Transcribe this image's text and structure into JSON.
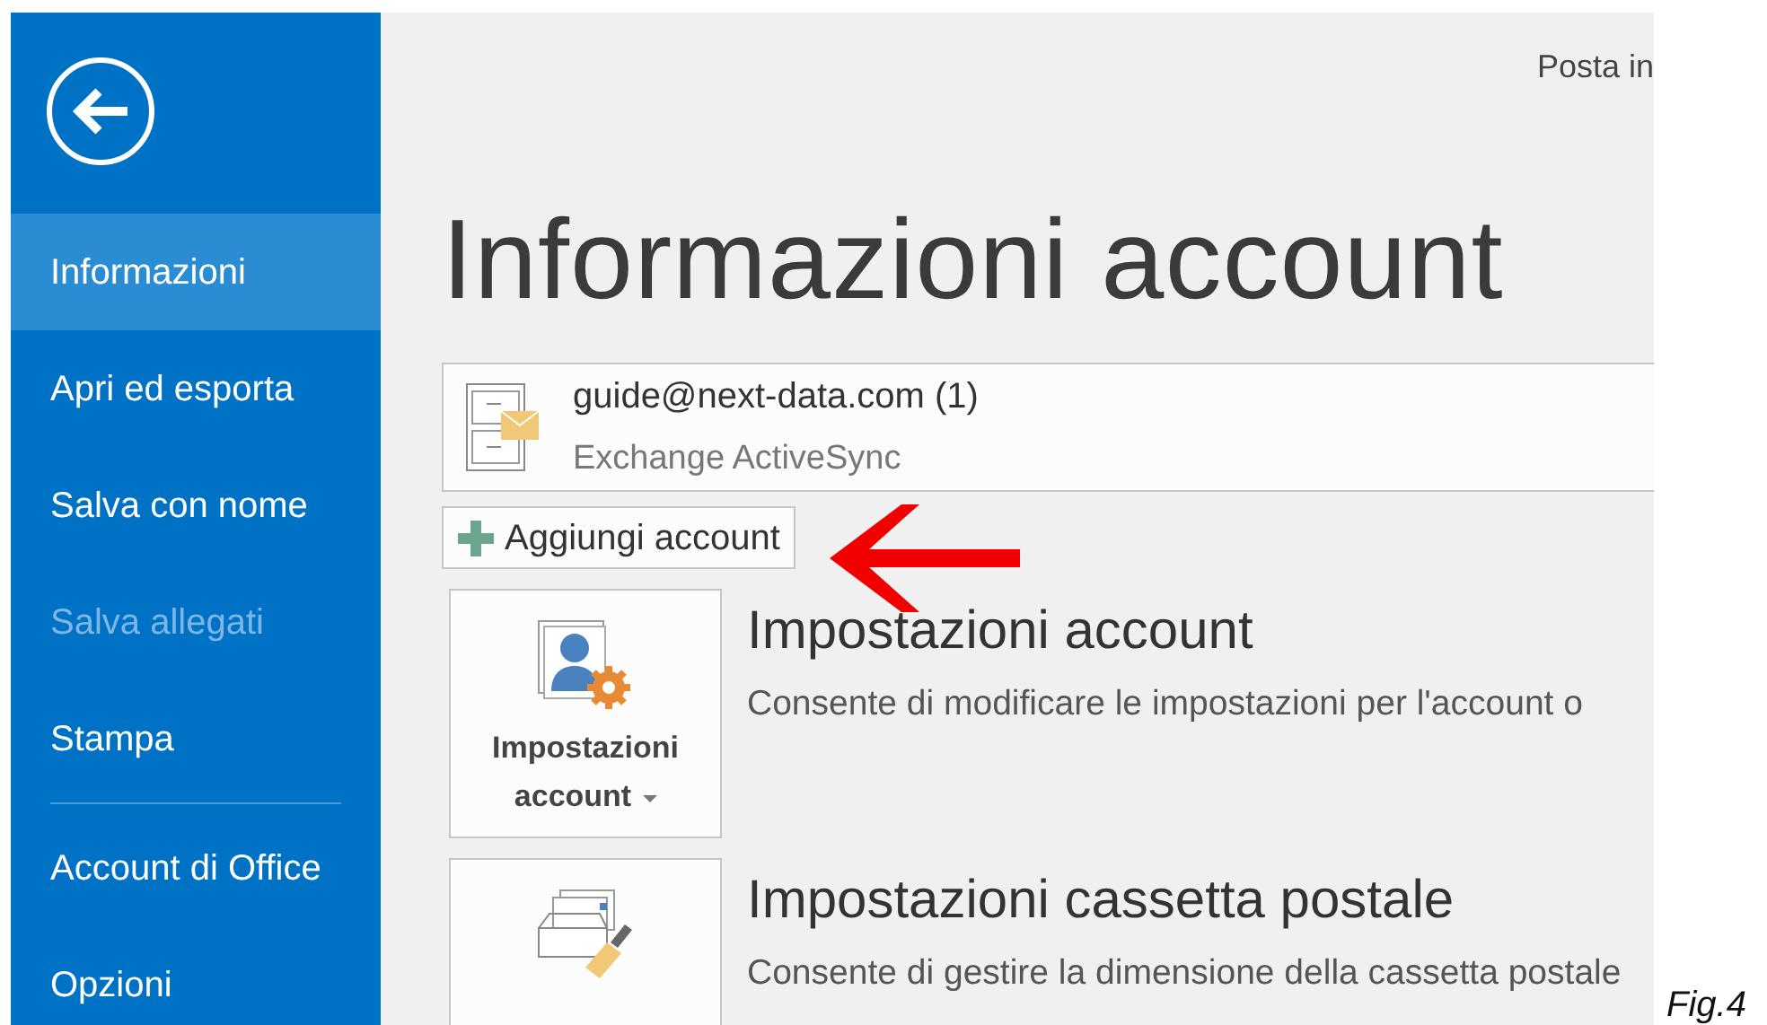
{
  "sidebar": {
    "groups": [
      [
        {
          "label": "Informazioni",
          "selected": true,
          "disabled": false
        },
        {
          "label": "Apri ed esporta",
          "selected": false,
          "disabled": false
        },
        {
          "label": "Salva con nome",
          "selected": false,
          "disabled": false
        },
        {
          "label": "Salva allegati",
          "selected": false,
          "disabled": true
        },
        {
          "label": "Stampa",
          "selected": false,
          "disabled": false
        }
      ],
      [
        {
          "label": "Account di Office",
          "selected": false,
          "disabled": false
        },
        {
          "label": "Opzioni",
          "selected": false,
          "disabled": false
        }
      ]
    ]
  },
  "header_text": "Posta in",
  "title": "Informazioni account",
  "account": {
    "email": "guide@next-data.com (1)",
    "type": "Exchange ActiveSync"
  },
  "add_account_button": "Aggiungi account",
  "sections": [
    {
      "kind": "account-settings",
      "button_label": "Impostazioni account",
      "dropdown": true,
      "heading": "Impostazioni account",
      "description": "Consente di modificare le impostazioni per l'account o"
    },
    {
      "kind": "mailbox-settings",
      "heading": "Impostazioni cassetta postale",
      "description": "Consente di gestire la dimensione della cassetta postale"
    }
  ],
  "caption": "Fig.4"
}
